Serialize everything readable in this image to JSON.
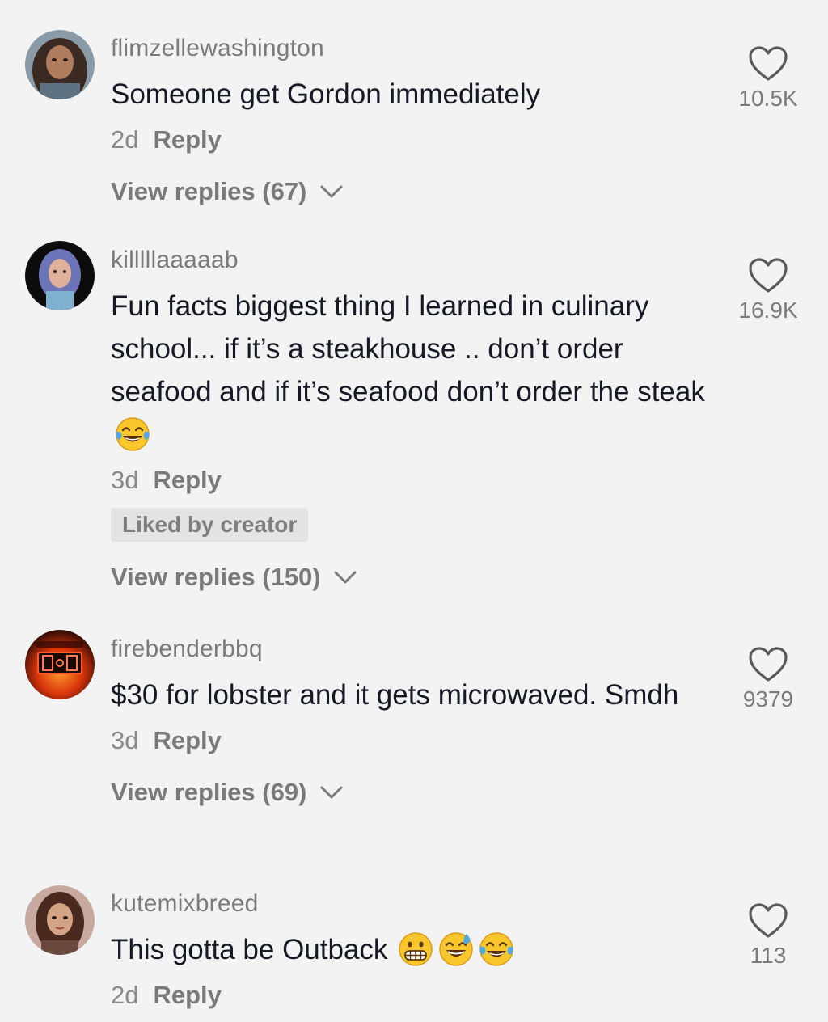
{
  "comments": [
    {
      "username": "flimzellewashington",
      "text": "Someone get Gordon immediately",
      "age": "2d",
      "reply_label": "Reply",
      "likes": "10.5K",
      "view_replies": "View replies (67)",
      "emojis": []
    },
    {
      "username": "killlllaaaaab",
      "text": "Fun facts biggest thing I learned in culinary school... if it’s a steakhouse .. don’t order seafood and if it’s seafood don’t order the steak",
      "age": "3d",
      "reply_label": "Reply",
      "likes": "16.9K",
      "liked_by_creator": "Liked by creator",
      "view_replies": "View replies (150)",
      "emojis": [
        "face-with-tears-of-joy"
      ]
    },
    {
      "username": "firebenderbbq",
      "text": "$30 for lobster and it gets microwaved. Smdh",
      "age": "3d",
      "reply_label": "Reply",
      "likes": "9379",
      "view_replies": "View replies (69)",
      "emojis": []
    },
    {
      "username": "kutemixbreed",
      "text": "This gotta be Outback",
      "age": "2d",
      "reply_label": "Reply",
      "likes": "113",
      "emojis": [
        "grimacing-face",
        "grinning-face-with-sweat",
        "face-with-tears-of-joy"
      ]
    }
  ],
  "colors": {
    "background": "#f3f3f3",
    "text": "#161823",
    "secondary": "#7b7b7b",
    "badge_bg": "#e4e4e4",
    "emoji_yellow": "#f9c72c"
  }
}
